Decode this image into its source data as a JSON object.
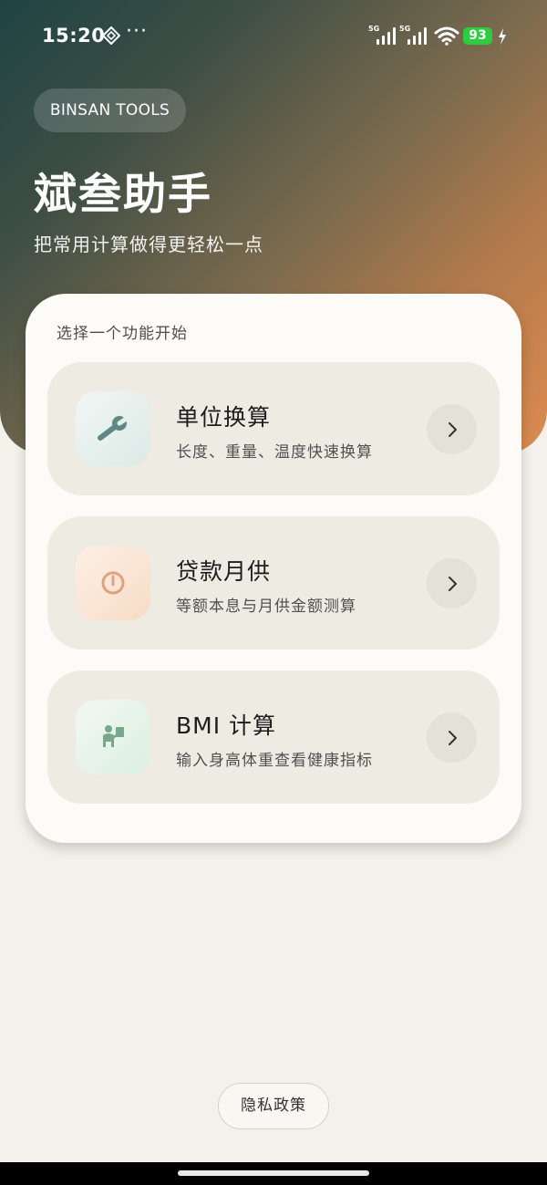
{
  "status_bar": {
    "time": "15:20",
    "more": "···",
    "sim1_label": "5G",
    "sim2_label": "5G",
    "battery": "93"
  },
  "header": {
    "brand": "BINSAN TOOLS",
    "title": "斌叁助手",
    "subtitle": "把常用计算做得更轻松一点"
  },
  "main": {
    "section_label": "选择一个功能开始",
    "features": [
      {
        "title": "单位换算",
        "desc": "长度、重量、温度快速换算",
        "icon": "wrench-icon",
        "icon_color": "#5f8884"
      },
      {
        "title": "贷款月供",
        "desc": "等额本息与月供金额测算",
        "icon": "power-icon",
        "icon_color": "#e0a27e"
      },
      {
        "title": "BMI 计算",
        "desc": "输入身高体重查看健康指标",
        "icon": "person-measure-icon",
        "icon_color": "#78a88a"
      }
    ]
  },
  "footer": {
    "privacy": "隐私政策"
  },
  "colors": {
    "accent_orange": "#dd8b4f",
    "accent_teal": "#1f4444",
    "battery_green": "#2ecc40"
  }
}
